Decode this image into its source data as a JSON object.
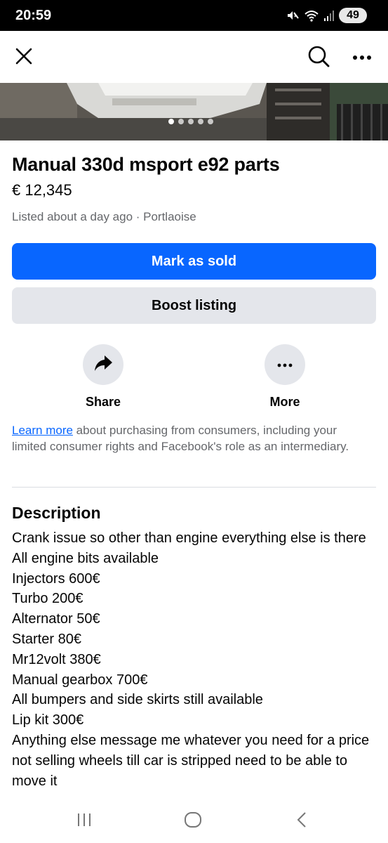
{
  "status_bar": {
    "time": "20:59",
    "battery": "49",
    "icons": [
      "mute-icon",
      "wifi-icon",
      "signal-icon",
      "battery-icon"
    ]
  },
  "top_bar": {
    "icons": [
      "close-icon",
      "search-icon",
      "more-horizontal-icon"
    ]
  },
  "photo": {
    "photo_count": 5,
    "active_index": 0
  },
  "listing": {
    "title": "Manual 330d msport e92 parts",
    "price": "€ 12,345",
    "listed": "Listed about a day ago · Portlaoise"
  },
  "buttons": {
    "mark_sold": "Mark as sold",
    "boost": "Boost listing"
  },
  "actions": {
    "share": "Share",
    "more": "More"
  },
  "notice": {
    "link": "Learn more",
    "text": " about purchasing from consumers, including your limited consumer rights and Facebook's role as an intermediary."
  },
  "description": {
    "heading": "Description",
    "lines": [
      "Crank issue so other than engine everything else is there",
      "All engine bits available",
      "Injectors 600€",
      "Turbo 200€",
      "Alternator 50€",
      "Starter 80€",
      "Mr12volt 380€",
      "Manual gearbox 700€",
      "All bumpers and side skirts still available",
      "Lip kit 300€",
      "Anything else message me whatever you need for a price not selling wheels till car is stripped need to be able to move it"
    ]
  },
  "colors": {
    "primary": "#0866ff",
    "secondary_bg": "#e4e6eb",
    "muted_text": "#65676b",
    "text": "#050505"
  }
}
